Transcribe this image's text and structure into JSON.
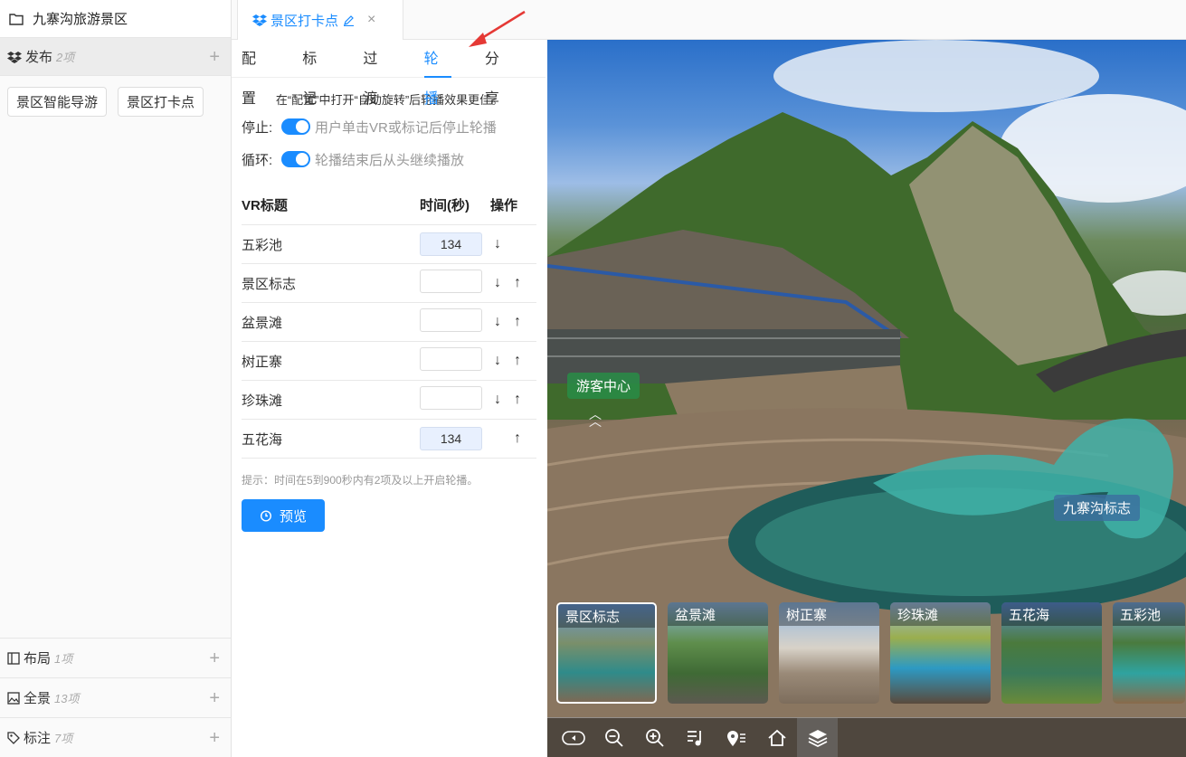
{
  "project": {
    "title": "九寨沟旅游景区"
  },
  "sidebar": {
    "publish": {
      "name": "发布",
      "count": "2项",
      "items": [
        "景区智能导游",
        "景区打卡点"
      ]
    },
    "bottom": [
      {
        "name": "布局",
        "count": "1项",
        "icon": "layout-icon"
      },
      {
        "name": "全景",
        "count": "13项",
        "icon": "image-icon"
      },
      {
        "name": "标注",
        "count": "7项",
        "icon": "tag-icon"
      }
    ]
  },
  "doc_tab": {
    "title": "景区打卡点",
    "close": "×"
  },
  "subtabs": [
    "配置",
    "标记",
    "过渡",
    "轮播",
    "分享"
  ],
  "carousel": {
    "hint": "在“配置”中打开“自动旋转”后轮播效果更佳。",
    "stop_label": "停止:",
    "stop_desc": "用户单击VR或标记后停止轮播",
    "loop_label": "循环:",
    "loop_desc": "轮播结束后从头继续播放",
    "headers": {
      "title": "VR标题",
      "time": "时间(秒)",
      "action": "操作"
    },
    "rows": [
      {
        "title": "五彩池",
        "time": "134",
        "down": "↓",
        "up": ""
      },
      {
        "title": "景区标志",
        "time": "",
        "down": "↓",
        "up": "↑"
      },
      {
        "title": "盆景滩",
        "time": "",
        "down": "↓",
        "up": "↑"
      },
      {
        "title": "树正寨",
        "time": "",
        "down": "↓",
        "up": "↑"
      },
      {
        "title": "珍珠滩",
        "time": "",
        "down": "↓",
        "up": "↑"
      },
      {
        "title": "五花海",
        "time": "134",
        "down": "",
        "up": "↑"
      }
    ],
    "tip": "提示：时间在5到900秒内有2项及以上开启轮播。",
    "preview": "预览"
  },
  "viewer": {
    "hotspots": [
      "游客中心",
      "九寨沟标志"
    ],
    "thumbnails": [
      "景区标志",
      "盆景滩",
      "树正寨",
      "珍珠滩",
      "五花海",
      "五彩池"
    ],
    "tools": [
      "vr-glasses-icon",
      "zoom-out-icon",
      "zoom-in-icon",
      "music-list-icon",
      "location-list-icon",
      "home-icon",
      "layers-icon"
    ]
  },
  "colors": {
    "accent": "#1a8cff",
    "annotation": "#e53935"
  }
}
